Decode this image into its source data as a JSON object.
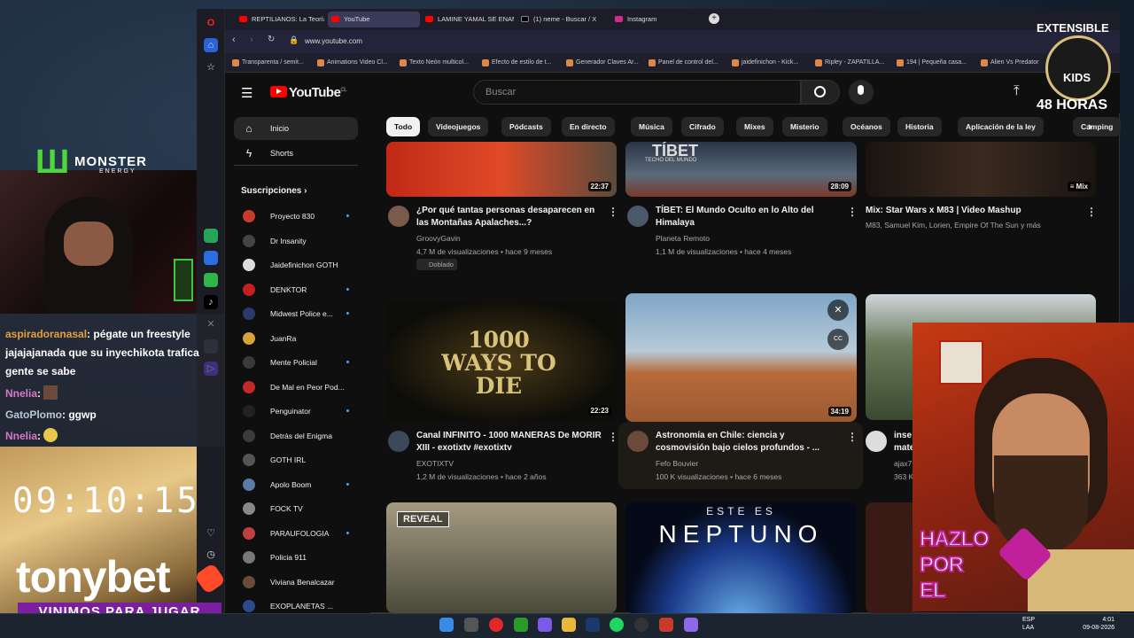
{
  "browser": {
    "tabs": [
      "REPTILIANOS: La Teoría C",
      "YouTube",
      "LAMINE YAMAL SE ENAM",
      "(1) neme - Buscar / X",
      "Instagram"
    ],
    "url": "www.youtube.com",
    "bookmarks": [
      "Transparenta / semit...",
      "Animations Video Cl...",
      "Texto Neón multicol...",
      "Efecto de estilo de t...",
      "Generador Claves Ar...",
      "Panel de control del...",
      "jaidefinichon - Kick...",
      "Ripley - ZAPATILLA...",
      "194 | Pequeña casa...",
      "Alien Vs Predator"
    ]
  },
  "youtube": {
    "logo": "YouTube",
    "logo_country": "CL",
    "search_placeholder": "Buscar",
    "nav": [
      {
        "label": "Inicio",
        "icon": "home-icon"
      },
      {
        "label": "Shorts",
        "icon": "shorts-icon"
      }
    ],
    "subs_heading": "Suscripciones",
    "subscriptions": [
      "Proyecto 830",
      "Dr Insanity",
      "Jaidefinichon GOTH",
      "DENKTOR",
      "Midwest Police e...",
      "JuanRa",
      "Mente Policial",
      "De Mal en Peor Pod...",
      "Penguinator",
      "Detrás del Enigma",
      "GOTH IRL",
      "Apolo Boom",
      "FOCK TV",
      "PARAUFOLOGIA",
      "Policia 911",
      "Viviana Benalcazar",
      "EXOPLANETAS ..."
    ],
    "chips": [
      "Todo",
      "Videojuegos",
      "Pódcasts",
      "En directo",
      "Música",
      "Cifrado",
      "Mixes",
      "Misterio",
      "Océanos",
      "Historia",
      "Aplicación de la ley",
      "Camping"
    ],
    "videos": [
      {
        "title": "¿Por qué tantas personas desaparecen en las Montañas Apalaches...?",
        "channel": "GroovyGavin",
        "meta": "4,7 M de visualizaciones • hace 9 meses",
        "badge": "Doblado",
        "duration": "22:37"
      },
      {
        "title": "TÍBET: El Mundo Oculto en lo Alto del Himalaya",
        "channel": "Planeta Remoto",
        "meta": "1,1 M de visualizaciones • hace 4 meses",
        "duration": "28:09",
        "thumb_text": "TÍBET",
        "thumb_sub": "TECHO DEL MUNDO"
      },
      {
        "title": "Mix: Star Wars x M83 | Video Mashup",
        "channel": "M83, Samuel Kim, Lorien, Empire Of The Sun y más",
        "meta": "",
        "duration": "Mix"
      },
      {
        "title": "Canal INFINITO - 1000 MANERAS De MORIR XIII - exotixtv #exotixtv",
        "channel": "EXOTIXTV",
        "meta": "1,2 M de visualizaciones • hace 2 años",
        "duration": "22:23",
        "thumb_text": "1000 WAYS TO DIE"
      },
      {
        "title": "Astronomía en Chile: ciencia y cosmovisión bajo cielos profundos - ...",
        "channel": "Fefo Bouvier",
        "meta": "100 K visualizaciones • hace 6 meses",
        "duration": "34:19"
      },
      {
        "title": "inse mate",
        "channel": "ajax7",
        "meta": "363 K",
        "duration": ""
      },
      {
        "title": "",
        "channel": "",
        "meta": "",
        "duration": "",
        "thumb_text": "REVEAL"
      },
      {
        "title": "",
        "channel": "",
        "meta": "",
        "duration": "",
        "thumb_text": "ESTE ES",
        "thumb_sub": "NEPTUNO"
      }
    ]
  },
  "stream": {
    "chat": [
      {
        "name": "aspiradoranasal",
        "text": ": pégate un freestyle"
      },
      {
        "name": "",
        "text": "jajajajanada que su inyechikota trafica"
      },
      {
        "name": "",
        "text": "gente se sabe"
      },
      {
        "name": "Nnelia",
        "text": ":"
      },
      {
        "name": "GatoPlomo",
        "text": ": ggwp"
      },
      {
        "name": "Nnelia",
        "text": ":"
      }
    ],
    "clock": "09:10:15",
    "brand": "tonybet",
    "slogan": "VINIMOS PARA JUGAR",
    "sponsor": "MONSTER",
    "sponsor_sub": "ENERGY",
    "badge_top": "EXTENSIBLE",
    "badge_mid": "KIDS",
    "badge_bottom": "48 HORAS",
    "hazlo": [
      "HAZLO",
      "POR",
      "EL"
    ]
  },
  "taskbar": {
    "lang": "ESP",
    "lang_sub": "LAA",
    "time": "4:01",
    "date": "09-08-2026"
  }
}
